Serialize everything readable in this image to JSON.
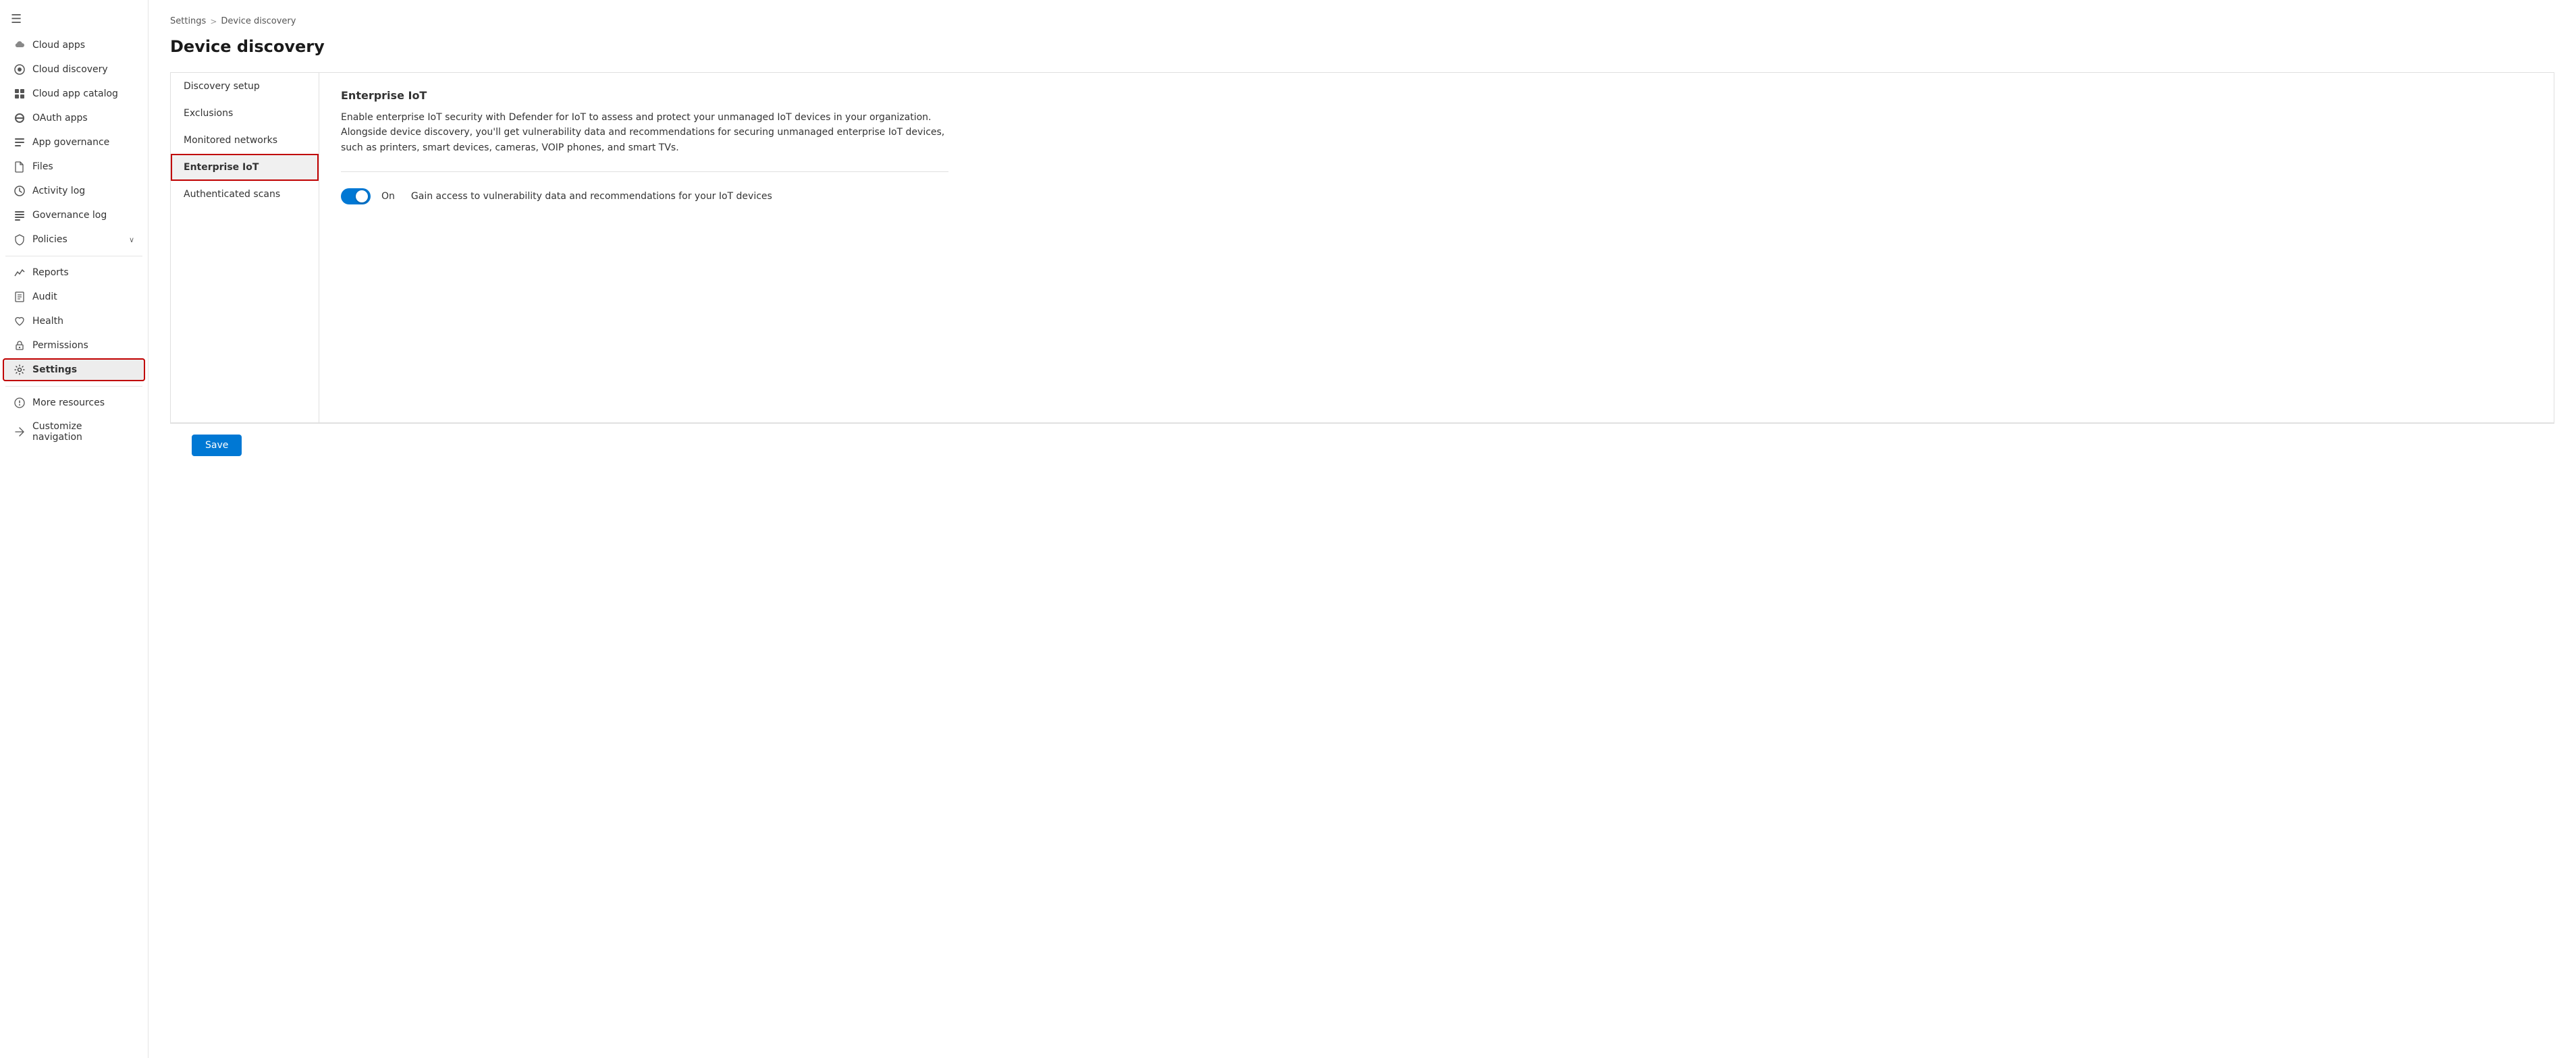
{
  "sidebar": {
    "hamburger_icon": "☰",
    "items": [
      {
        "id": "cloud-apps",
        "label": "Cloud apps",
        "icon": "cloud-apps-icon",
        "active": false
      },
      {
        "id": "cloud-discovery",
        "label": "Cloud discovery",
        "icon": "cloud-discovery-icon",
        "active": false
      },
      {
        "id": "cloud-app-catalog",
        "label": "Cloud app catalog",
        "icon": "cloud-app-catalog-icon",
        "active": false
      },
      {
        "id": "oauth-apps",
        "label": "OAuth apps",
        "icon": "oauth-apps-icon",
        "active": false
      },
      {
        "id": "app-governance",
        "label": "App governance",
        "icon": "app-governance-icon",
        "active": false
      },
      {
        "id": "files",
        "label": "Files",
        "icon": "files-icon",
        "active": false
      },
      {
        "id": "activity-log",
        "label": "Activity log",
        "icon": "activity-log-icon",
        "active": false
      },
      {
        "id": "governance-log",
        "label": "Governance log",
        "icon": "governance-log-icon",
        "active": false
      },
      {
        "id": "policies",
        "label": "Policies",
        "icon": "policies-icon",
        "active": false,
        "has_chevron": true
      },
      {
        "id": "reports",
        "label": "Reports",
        "icon": "reports-icon",
        "active": false
      },
      {
        "id": "audit",
        "label": "Audit",
        "icon": "audit-icon",
        "active": false
      },
      {
        "id": "health",
        "label": "Health",
        "icon": "health-icon",
        "active": false
      },
      {
        "id": "permissions",
        "label": "Permissions",
        "icon": "permissions-icon",
        "active": false
      },
      {
        "id": "settings",
        "label": "Settings",
        "icon": "settings-icon",
        "active": true
      },
      {
        "id": "more-resources",
        "label": "More resources",
        "icon": "more-resources-icon",
        "active": false
      },
      {
        "id": "customize-navigation",
        "label": "Customize navigation",
        "icon": "customize-nav-icon",
        "active": false
      }
    ]
  },
  "breadcrumb": {
    "items": [
      "Settings",
      "Device discovery"
    ],
    "separator": ">"
  },
  "page_title": "Device discovery",
  "tabs": [
    {
      "id": "discovery-setup",
      "label": "Discovery setup",
      "active": false
    },
    {
      "id": "exclusions",
      "label": "Exclusions",
      "active": false
    },
    {
      "id": "monitored-networks",
      "label": "Monitored networks",
      "active": false
    },
    {
      "id": "enterprise-iot",
      "label": "Enterprise IoT",
      "active": true
    },
    {
      "id": "authenticated-scans",
      "label": "Authenticated scans",
      "active": false
    }
  ],
  "enterprise_iot": {
    "title": "Enterprise IoT",
    "description": "Enable enterprise IoT security with Defender for IoT to assess and protect your unmanaged IoT devices in your organization. Alongside device discovery, you'll get vulnerability data and recommendations for securing unmanaged enterprise IoT devices, such as printers, smart devices, cameras, VOIP phones, and smart TVs.",
    "toggle": {
      "is_on": true,
      "label": "On",
      "description": "Gain access to vulnerability data and recommendations for your IoT devices"
    }
  },
  "save_button_label": "Save"
}
